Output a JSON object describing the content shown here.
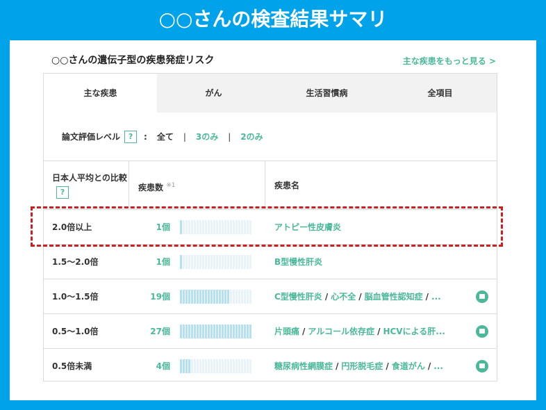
{
  "slide_title": "○○さんの検査結果サマリ",
  "section_title": "○○さんの遺伝子型の疾患発症リスク",
  "more_link": "主な疾患をもっと見る >",
  "tabs": [
    {
      "label": "主な疾患",
      "active": true
    },
    {
      "label": "がん",
      "active": false
    },
    {
      "label": "生活習慣病",
      "active": false
    },
    {
      "label": "全項目",
      "active": false
    }
  ],
  "filter": {
    "label": "論文評価レベル",
    "help": "?",
    "colon": ":",
    "options": [
      "全て",
      "3のみ",
      "2のみ"
    ],
    "separator": "|"
  },
  "table": {
    "header": {
      "ratio": "日本人平均との比較",
      "ratio_help": "?",
      "count": "疾患数",
      "count_note": "※1",
      "names": "疾患名"
    },
    "rows": [
      {
        "ratio": "2.0倍以上",
        "count": "1個",
        "count_value": 1,
        "names": [
          "アトピー性皮膚炎"
        ],
        "more": false
      },
      {
        "ratio": "1.5〜2.0倍",
        "count": "1個",
        "count_value": 1,
        "names": [
          "B型慢性肝炎"
        ],
        "more": false
      },
      {
        "ratio": "1.0〜1.5倍",
        "count": "19個",
        "count_value": 19,
        "names": [
          "C型慢性肝炎",
          "心不全",
          "脳血管性認知症",
          "..."
        ],
        "more": true
      },
      {
        "ratio": "0.5〜1.0倍",
        "count": "27個",
        "count_value": 27,
        "names": [
          "片頭痛",
          "アルコール依存症",
          "HCVによる肝..."
        ],
        "more": true
      },
      {
        "ratio": "0.5倍未満",
        "count": "4個",
        "count_value": 4,
        "names": [
          "糖尿病性網膜症",
          "円形脱毛症",
          "食道がん",
          "..."
        ],
        "more": true
      }
    ]
  },
  "colors": {
    "background": "#00a3ea",
    "accent": "#4bb89a",
    "bar_on": "#b3e0f5",
    "bar_off": "#e6f3fa",
    "highlight": "#cc1f1f"
  },
  "icons": {
    "row_more": "chat-bubble-icon"
  }
}
